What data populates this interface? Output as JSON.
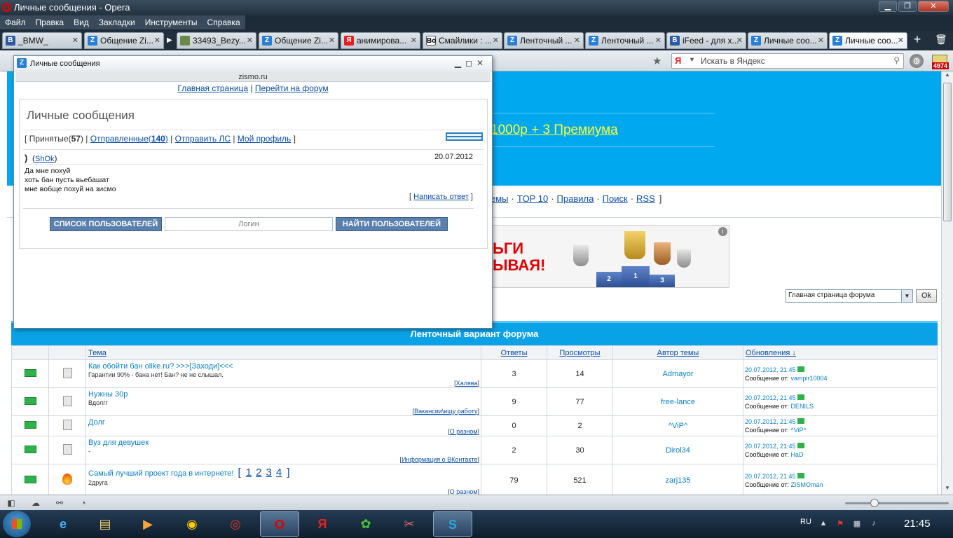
{
  "window": {
    "title": "Личные сообщения - Opera"
  },
  "menu": [
    "Файл",
    "Правка",
    "Вид",
    "Закладки",
    "Инструменты",
    "Справка"
  ],
  "tabs": [
    {
      "label": "_BMW_",
      "fav": "B"
    },
    {
      "label": "Общение Zi...",
      "fav": "Z"
    },
    {
      "label": "33493_Bezy...",
      "fav": "img"
    },
    {
      "label": "Общение Zi...",
      "fav": "Z"
    },
    {
      "label": "анимирова...",
      "fav": "Я"
    },
    {
      "label": "Смайлики : ...",
      "fav": "Bo"
    },
    {
      "label": "Ленточный ...",
      "fav": "Z"
    },
    {
      "label": "Ленточный ...",
      "fav": "Z"
    },
    {
      "label": "iFeed - для х...",
      "fav": "B"
    },
    {
      "label": "Личные соо...",
      "fav": "Z"
    },
    {
      "label": "Личные соо...",
      "fav": "Z"
    }
  ],
  "search": {
    "placeholder": "Искать в Яндекс"
  },
  "mail_badge": "4974",
  "page": {
    "promo": "1000р + 3 Премиума",
    "nav": [
      "емы",
      "TOP 10",
      "Правила",
      "Поиск",
      "RSS"
    ],
    "banner": {
      "line1": "ЬГИ",
      "line2": "ЫВАЯ!",
      "podium": [
        "2",
        "1",
        "3"
      ]
    },
    "jump": {
      "selected": "Главная страница форума",
      "ok": "Ok"
    },
    "forum": {
      "caption": "Ленточный вариант форума",
      "columns": [
        "Тема",
        "Ответы",
        "Просмотры",
        "Автор темы",
        "Обновления"
      ],
      "rows": [
        {
          "title": "Как обойти бан olike.ru? >>>[Заходи]<<<",
          "desc": "Гарантии 90% - бана нет! Бан? не не слышал.",
          "cat": "Халява",
          "replies": "3",
          "views": "14",
          "author": "Admayor",
          "date": "20.07.2012, 21:45",
          "by": "vampir10004",
          "icon": "doc",
          "pages": []
        },
        {
          "title": "Нужны 30р",
          "desc": "Вдолгг",
          "cat": "Вакансии\\ищу работу",
          "replies": "9",
          "views": "77",
          "author": "free-lance",
          "date": "20.07.2012, 21:45",
          "by": "DENILS",
          "icon": "doc",
          "pages": []
        },
        {
          "title": "Долг",
          "desc": "",
          "cat": "О разном",
          "replies": "0",
          "views": "2",
          "author": "^ViP^",
          "date": "20.07.2012, 21:45",
          "by": "^ViP^",
          "icon": "doc",
          "pages": []
        },
        {
          "title": "Вуз для девушек",
          "desc": "-",
          "cat": "Информация о ВКонтакте",
          "replies": "2",
          "views": "30",
          "author": "Dirol34",
          "date": "20.07.2012, 21:45",
          "by": "HaD",
          "icon": "doc",
          "pages": []
        },
        {
          "title": "Самый лучший проект года в интернете!",
          "desc": "2друга",
          "cat": "О разном",
          "replies": "79",
          "views": "521",
          "author": "zarj135",
          "date": "20.07.2012, 21:45",
          "by": "ZISMOman",
          "icon": "fire",
          "pages": [
            "1",
            "2",
            "3",
            "4"
          ]
        }
      ],
      "msg_from_label": "Сообщение от:"
    }
  },
  "popup": {
    "title": "Личные сообщения",
    "site": "zismo.ru",
    "link_home": "Главная страница",
    "link_forum": "Перейти на форум",
    "heading": "Личные сообщения",
    "inbox_label": "Принятые",
    "inbox_count": "57",
    "sent_label": "Отправленные",
    "sent_count": "140",
    "send_pm": "Отправить ЛС",
    "my_profile": "Мой профиль",
    "subject": ")",
    "sender": "ShOk",
    "date": "20.07.2012",
    "message": [
      "Да мне похуй",
      "хоть бан пусть вьебашат",
      "мне вобще похуй на зисмо"
    ],
    "reply": "Написать ответ",
    "users_list_btn": "СПИСОК ПОЛЬЗОВАТЕЛЕЙ",
    "login_placeholder": "Логин",
    "find_users_btn": "НАЙТИ ПОЛЬЗОВАТЕЛЕЙ"
  },
  "taskbar": {
    "lang": "RU",
    "clock": "21:45"
  }
}
